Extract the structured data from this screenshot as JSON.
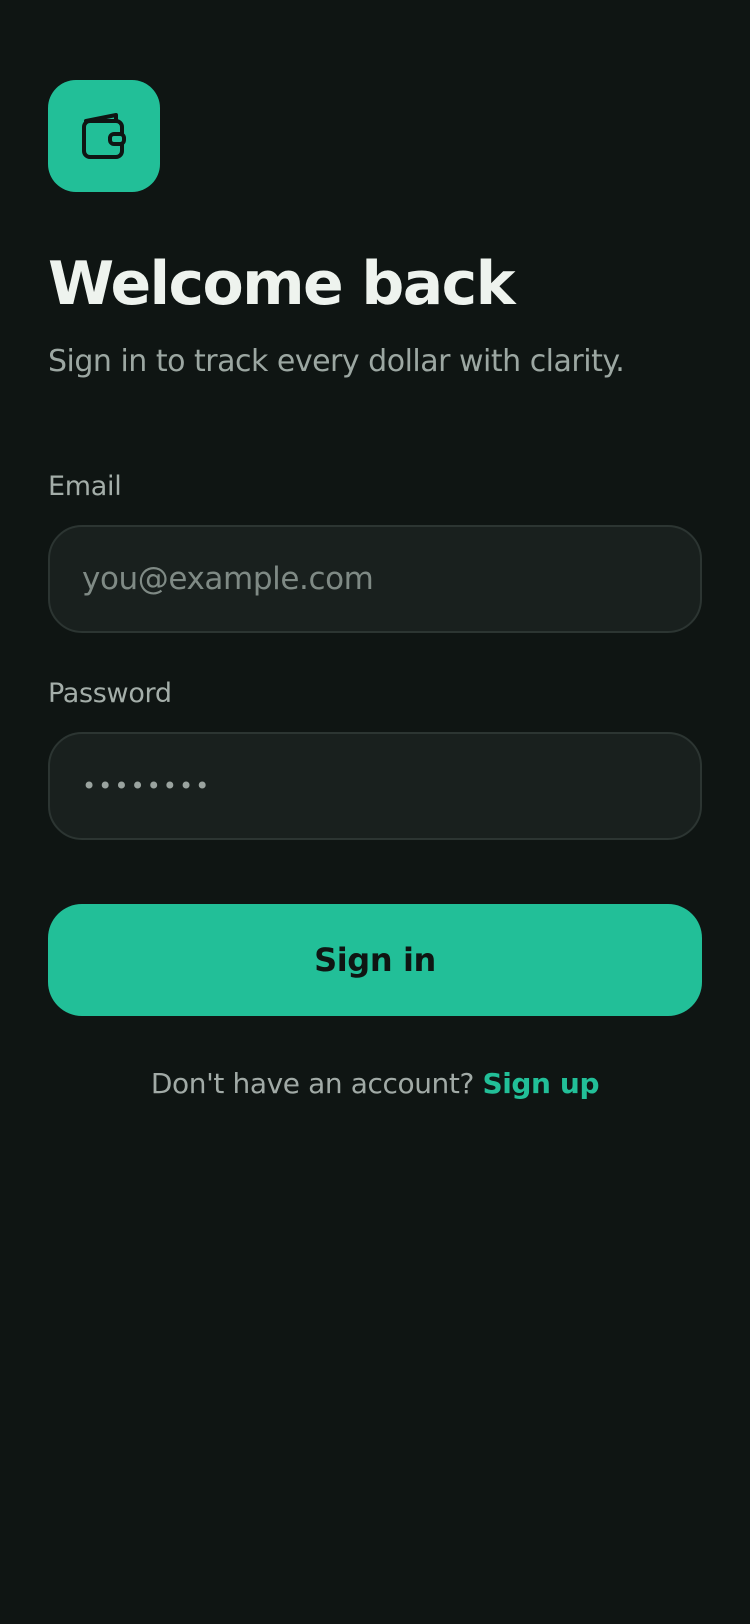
{
  "brand": {
    "logo_icon": "wallet-icon",
    "accent_color": "#22bf98",
    "background_color": "#0f1513"
  },
  "header": {
    "title": "Welcome back",
    "subtitle": "Sign in to track every dollar with clarity."
  },
  "form": {
    "email": {
      "label": "Email",
      "placeholder": "you@example.com",
      "value": ""
    },
    "password": {
      "label": "Password",
      "masked_value": "••••••••"
    },
    "submit_label": "Sign in"
  },
  "footer": {
    "prompt": "Don't have an account?",
    "link_label": "Sign up"
  }
}
